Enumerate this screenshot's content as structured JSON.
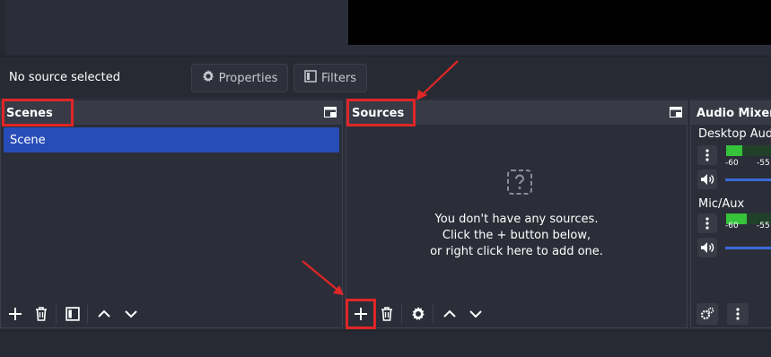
{
  "context_bar": {
    "no_source_label": "No source selected",
    "properties_label": "Properties",
    "filters_label": "Filters"
  },
  "scenes": {
    "title": "Scenes",
    "items": [
      {
        "label": "Scene",
        "selected": true
      }
    ]
  },
  "sources": {
    "title": "Sources",
    "empty_line1": "You don't have any sources.",
    "empty_line2": "Click the + button below,",
    "empty_line3": "or right click here to add one."
  },
  "audio_mixer": {
    "title": "Audio Mixer",
    "channels": [
      {
        "name": "Desktop Audi",
        "tick_a": "-60",
        "tick_b": "-55",
        "level": 0.35
      },
      {
        "name": "Mic/Aux",
        "tick_a": "-60",
        "tick_b": "-55",
        "level": 0.45
      }
    ]
  },
  "colors": {
    "accent": "#284cb8",
    "highlight": "#e02626",
    "meter": "#36c23b"
  }
}
